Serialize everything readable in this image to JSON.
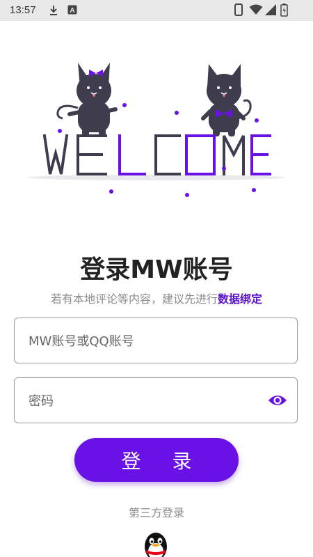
{
  "status_bar": {
    "time": "13:57"
  },
  "hero": {
    "welcome_text": "WELCOME"
  },
  "login": {
    "title": "登录MW账号",
    "subtitle_prefix": "若有本地评论等内容，建议先进行",
    "subtitle_link": "数据绑定",
    "account_placeholder": "MW账号或QQ账号",
    "password_placeholder": "密码",
    "login_button": "登 录",
    "third_party_label": "第三方登录"
  },
  "colors": {
    "accent": "#6a11e6",
    "link": "#5b14c8",
    "cat_body": "#3f3c4d",
    "status_bar_bg": "#e8e8e8"
  },
  "icons": [
    "download-icon",
    "a-notification-icon",
    "phone-icon",
    "wifi-icon",
    "signal-icon",
    "battery-icon",
    "eye-icon",
    "qq-penguin-icon"
  ]
}
